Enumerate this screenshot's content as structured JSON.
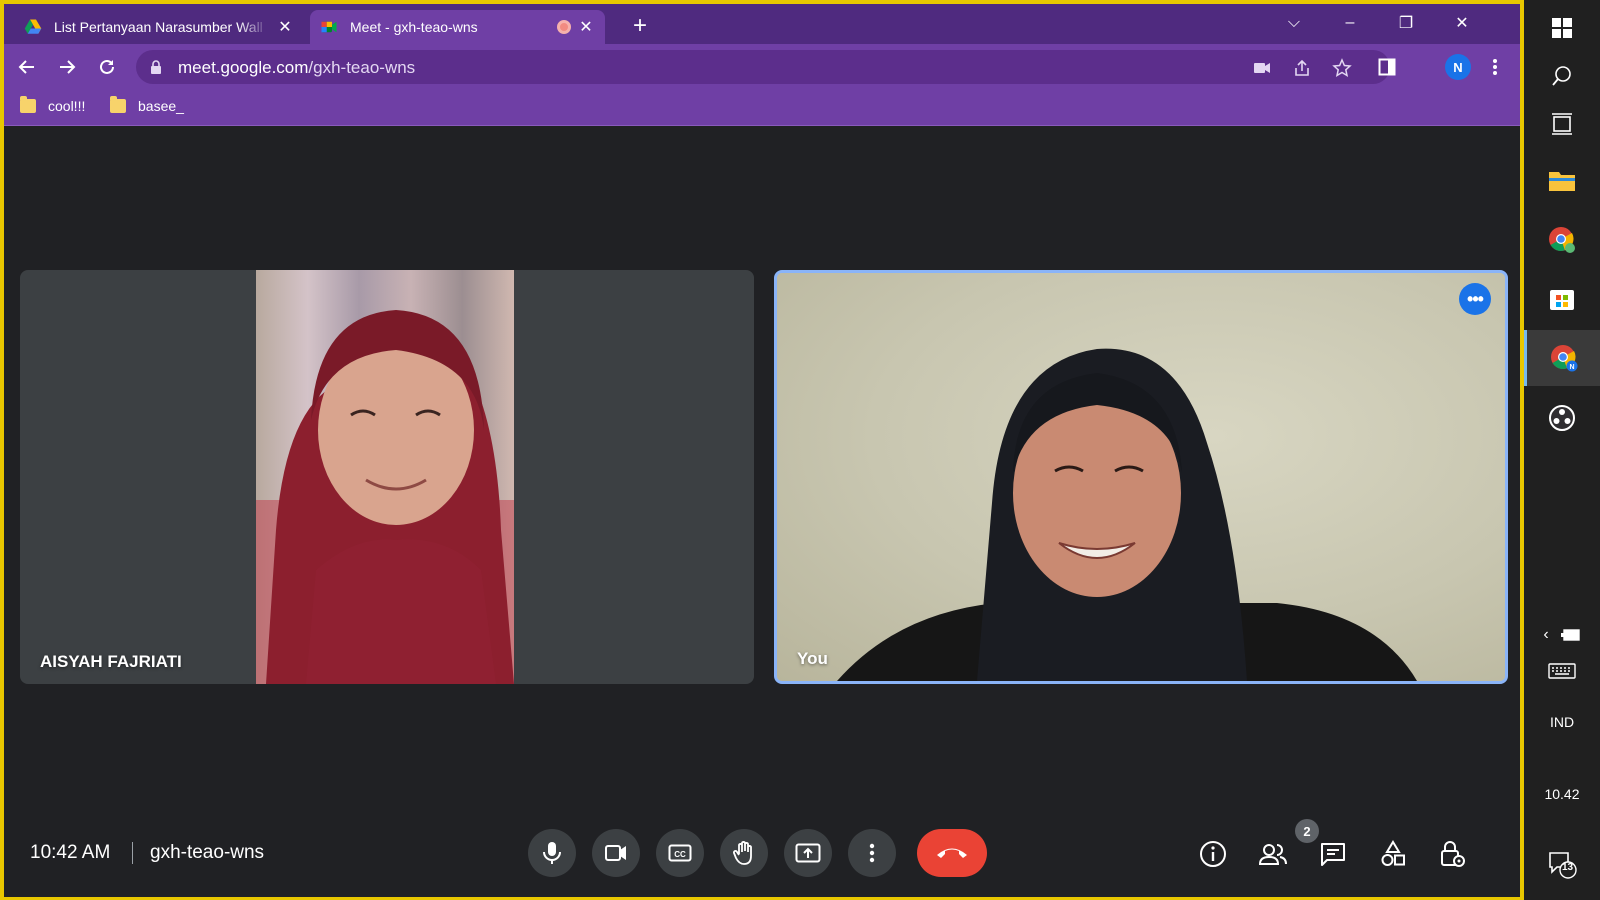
{
  "browser": {
    "tabs": [
      {
        "title": "List Pertanyaan Narasumber Wall",
        "active": false,
        "favicon": "google-drive-icon"
      },
      {
        "title": "Meet - gxh-teao-wns",
        "active": true,
        "favicon": "google-meet-icon",
        "recording": true
      }
    ],
    "url_host": "meet.google.com",
    "url_path": "/gxh-teao-wns",
    "profile_initial": "N",
    "bookmarks": [
      {
        "label": "cool!!!"
      },
      {
        "label": "basee_"
      }
    ]
  },
  "meet": {
    "participants": [
      {
        "name": "AISYAH FAJRIATI"
      },
      {
        "name": "You",
        "is_self": true
      }
    ],
    "time": "10:42 AM",
    "meeting_code": "gxh-teao-wns",
    "people_count": "2",
    "colors": {
      "accent": "#1a73e8",
      "end_call": "#ea4335",
      "self_border": "#8ab4f8",
      "background": "#202124"
    }
  },
  "taskbar": {
    "language": "IND",
    "clock": "10.42",
    "notifications": "13"
  }
}
